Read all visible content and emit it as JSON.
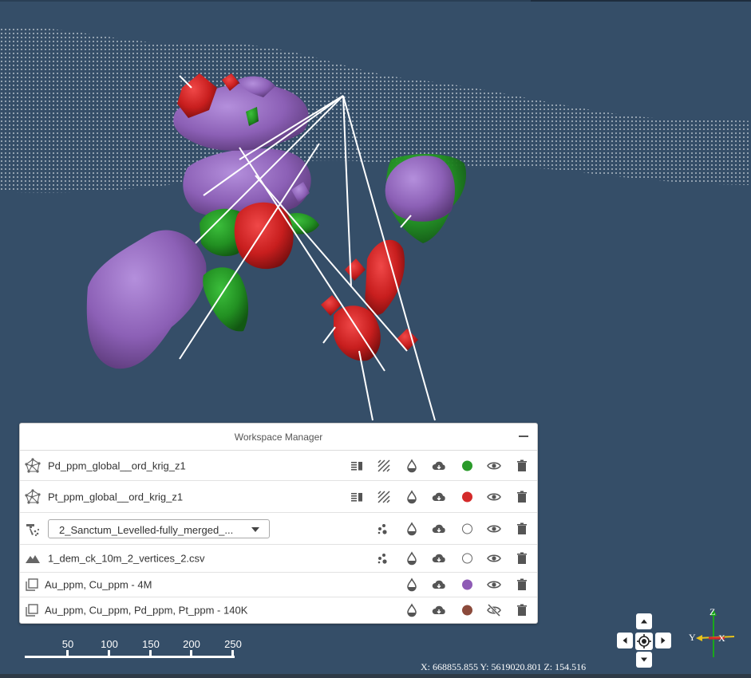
{
  "workspace_manager": {
    "title": "Workspace Manager",
    "rows": [
      {
        "name": "Pd_ppm_global__ord_krig_z1",
        "color": "#2a9a2a"
      },
      {
        "name": "Pt_ppm_global__ord_krig_z1",
        "color": "#d42a2a"
      },
      {
        "select_value": "2_Sanctum_Levelled-fully_merged_...",
        "color": "hollow"
      },
      {
        "name": "1_dem_ck_10m_2_vertices_2.csv",
        "color": "hollow"
      },
      {
        "name": "Au_ppm, Cu_ppm - 4M",
        "color": "#8e5bb5"
      },
      {
        "name": "Au_ppm, Cu_ppm, Pd_ppm, Pt_ppm - 140K",
        "color": "#8b4a3b"
      }
    ]
  },
  "scale_bar": {
    "ticks": [
      "50",
      "100",
      "150",
      "200",
      "250"
    ]
  },
  "axes": {
    "z": "Z",
    "y": "Y",
    "x": "X"
  },
  "coordinates": {
    "text": "X: 668855.855  Y: 5619020.801  Z: 154.516"
  },
  "icons": {
    "row1_lead": "mesh-icon",
    "row3_lead": "drill-icon",
    "row4_lead": "terrain-icon",
    "row5_lead": "layers-icon",
    "actions": [
      "legend-icon",
      "hatch-icon",
      "opacity-icon",
      "download-icon",
      "color-swatch",
      "visibility-icon",
      "delete-icon",
      "points-icon",
      "visibility-off-icon"
    ]
  }
}
